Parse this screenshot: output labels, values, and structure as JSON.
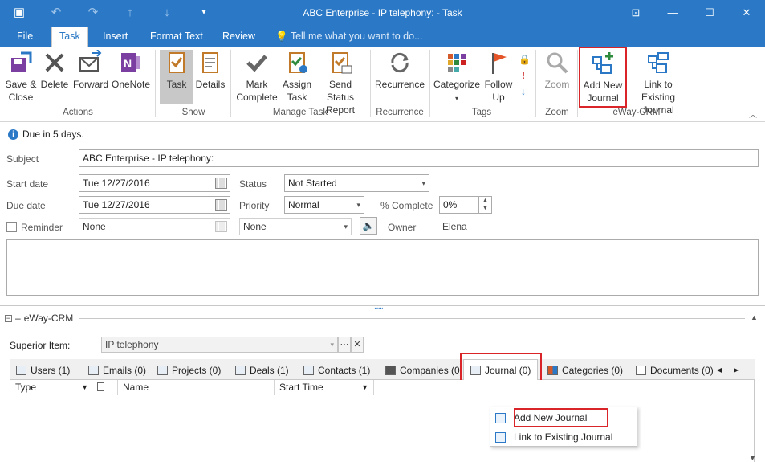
{
  "window": {
    "title": "ABC Enterprise - IP telephony:  - Task"
  },
  "ribbon_tabs": [
    "File",
    "Task",
    "Insert",
    "Format Text",
    "Review"
  ],
  "tell_me": "Tell me what you want to do...",
  "ribbon": {
    "actions": {
      "group": "Actions",
      "save_close": "Save &\nClose",
      "delete": "Delete",
      "forward": "Forward",
      "onenote": "OneNote"
    },
    "show": {
      "group": "Show",
      "task": "Task",
      "details": "Details"
    },
    "manage": {
      "group": "Manage Task",
      "mark_complete": "Mark\nComplete",
      "assign_task": "Assign\nTask",
      "send_status": "Send Status\nReport"
    },
    "recurrence": {
      "group": "Recurrence",
      "recurrence": "Recurrence"
    },
    "tags": {
      "group": "Tags",
      "categorize": "Categorize",
      "follow_up": "Follow\nUp"
    },
    "zoom": {
      "group": "Zoom",
      "zoom": "Zoom"
    },
    "eway": {
      "group": "eWay-CRM",
      "add_journal": "Add New\nJournal",
      "link_existing": "Link to Existing\nJournal"
    }
  },
  "form": {
    "info": "Due in 5 days.",
    "subject_label": "Subject",
    "subject": "ABC Enterprise - IP telephony:",
    "start_label": "Start date",
    "start": "Tue 12/27/2016",
    "due_label": "Due date",
    "due": "Tue 12/27/2016",
    "status_label": "Status",
    "status": "Not Started",
    "priority_label": "Priority",
    "priority": "Normal",
    "complete_label": "% Complete",
    "complete": "0%",
    "reminder_label": "Reminder",
    "reminder_date": "None",
    "reminder_time": "None",
    "owner_label": "Owner",
    "owner": "Elena"
  },
  "crm": {
    "header": "eWay-CRM",
    "superior_label": "Superior Item:",
    "superior_value": "IP telephony",
    "tabs": [
      "Users (1)",
      "Emails (0)",
      "Projects (0)",
      "Deals (1)",
      "Contacts (1)",
      "Companies (0)",
      "Journal (0)",
      "Categories (0)",
      "Documents (0)"
    ],
    "columns": [
      "Type",
      "Name",
      "Start Time"
    ],
    "context_menu": [
      "Add New Journal",
      "Link to Existing Journal"
    ]
  },
  "colors": {
    "accent": "#2b79c6",
    "highlight": "#d9242a"
  }
}
